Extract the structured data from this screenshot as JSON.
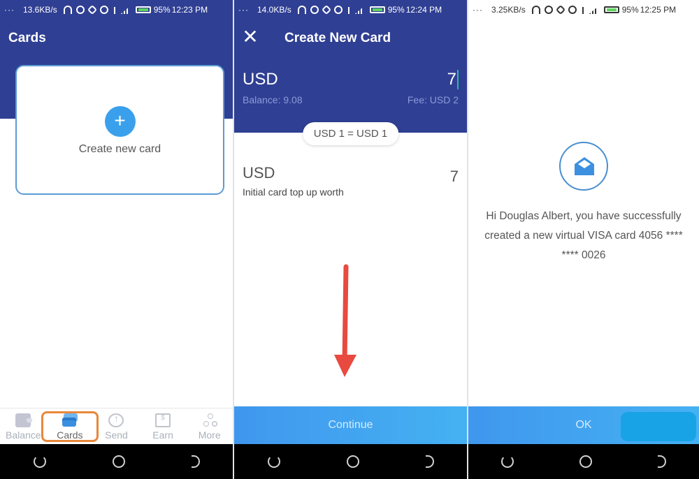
{
  "screens": [
    {
      "status_bar": {
        "dots": "···",
        "speed": "13.6KB/s",
        "battery": "95%",
        "time": "12:23 PM"
      },
      "header": {
        "title": "Cards"
      },
      "create_card": {
        "label": "Create new card",
        "icon": "plus-icon"
      },
      "bottom_nav": {
        "items": [
          {
            "label": "Balance",
            "icon": "wallet-icon",
            "active": false
          },
          {
            "label": "Cards",
            "icon": "cards-icon",
            "active": true
          },
          {
            "label": "Send",
            "icon": "send-icon",
            "active": false
          },
          {
            "label": "Earn",
            "icon": "gift-icon",
            "active": false
          },
          {
            "label": "More",
            "icon": "more-icon",
            "active": false
          }
        ]
      }
    },
    {
      "status_bar": {
        "dots": "···",
        "speed": "14.0KB/s",
        "battery": "95%",
        "time": "12:24 PM"
      },
      "header": {
        "title": "Create New Card",
        "close_icon": "✕"
      },
      "from": {
        "currency": "USD",
        "amount": "7",
        "balance": "Balance: 9.08",
        "fee": "Fee: USD 2"
      },
      "rate": "USD 1 = USD 1",
      "to": {
        "currency": "USD",
        "amount": "7",
        "description": "Initial card top up worth"
      },
      "action": {
        "label": "Continue"
      }
    },
    {
      "status_bar": {
        "dots": "···",
        "speed": "3.25KB/s",
        "battery": "95%",
        "time": "12:25 PM"
      },
      "message": "Hi Douglas Albert, you have successfully created a new virtual VISA card 4056 **** **** 0026",
      "action": {
        "label": "OK"
      }
    }
  ],
  "colors": {
    "header_bg": "#2f3f93",
    "accent_blue": "#3ba0ec",
    "button_gradient_start": "#4097ee",
    "button_gradient_end": "#45b1f2",
    "highlight_orange": "#e8873a",
    "annotation_arrow": "#e84a3f"
  }
}
